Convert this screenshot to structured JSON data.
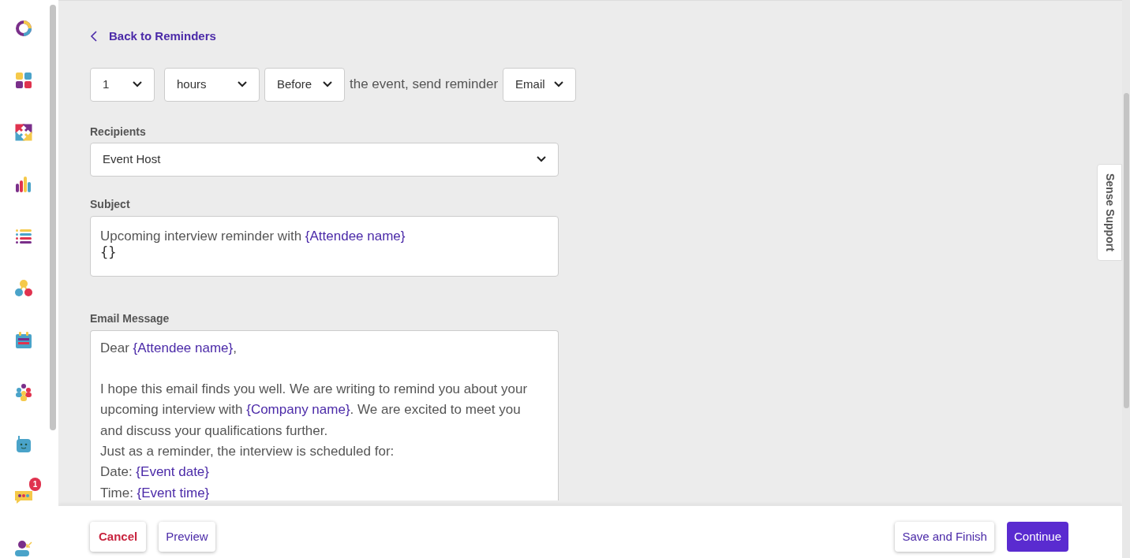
{
  "sidebar": {
    "items": [
      {
        "kind": "donut"
      },
      {
        "kind": "tiles"
      },
      {
        "kind": "arrows"
      },
      {
        "kind": "bars"
      },
      {
        "kind": "list"
      },
      {
        "kind": "nodes"
      },
      {
        "kind": "calendar"
      },
      {
        "kind": "people"
      },
      {
        "kind": "robot"
      },
      {
        "kind": "chat",
        "badge": "1"
      },
      {
        "kind": "person"
      }
    ]
  },
  "back_link": "Back to Reminders",
  "timing": {
    "amount": "1",
    "unit": "hours",
    "relation": "Before",
    "connector": "the event, send reminder",
    "channel": "Email"
  },
  "recipients": {
    "label": "Recipients",
    "value": "Event Host"
  },
  "subject": {
    "label": "Subject",
    "segments": [
      {
        "kind": "plain",
        "text": "Upcoming interview reminder with "
      },
      {
        "kind": "var",
        "text": "{Attendee name}"
      }
    ],
    "cursor_hint": "{}"
  },
  "email_message": {
    "label": "Email Message",
    "lines": [
      [
        {
          "kind": "plain",
          "text": "Dear "
        },
        {
          "kind": "var",
          "text": "{Attendee name}"
        },
        {
          "kind": "plain",
          "text": ","
        }
      ],
      [
        {
          "kind": "plain",
          "space_before": true,
          "text": "I hope this email finds you well. We are writing to remind you about your"
        }
      ],
      [
        {
          "kind": "plain",
          "text": "upcoming interview with "
        },
        {
          "kind": "var",
          "text": "{Company name}"
        },
        {
          "kind": "plain",
          "text": ". We are excited to meet you"
        }
      ],
      [
        {
          "kind": "plain",
          "text": "and discuss your qualifications further."
        }
      ],
      [
        {
          "kind": "plain",
          "text": "Just as a reminder, the interview is scheduled for:"
        }
      ],
      [
        {
          "kind": "plain",
          "text": "Date: "
        },
        {
          "kind": "var",
          "text": "{Event date}"
        }
      ],
      [
        {
          "kind": "plain",
          "text": "Time: "
        },
        {
          "kind": "var",
          "text": "{Event time}"
        }
      ]
    ]
  },
  "support_tab": "Sense Support",
  "footer": {
    "cancel": "Cancel",
    "preview": "Preview",
    "save": "Save and Finish",
    "continue": "Continue"
  }
}
